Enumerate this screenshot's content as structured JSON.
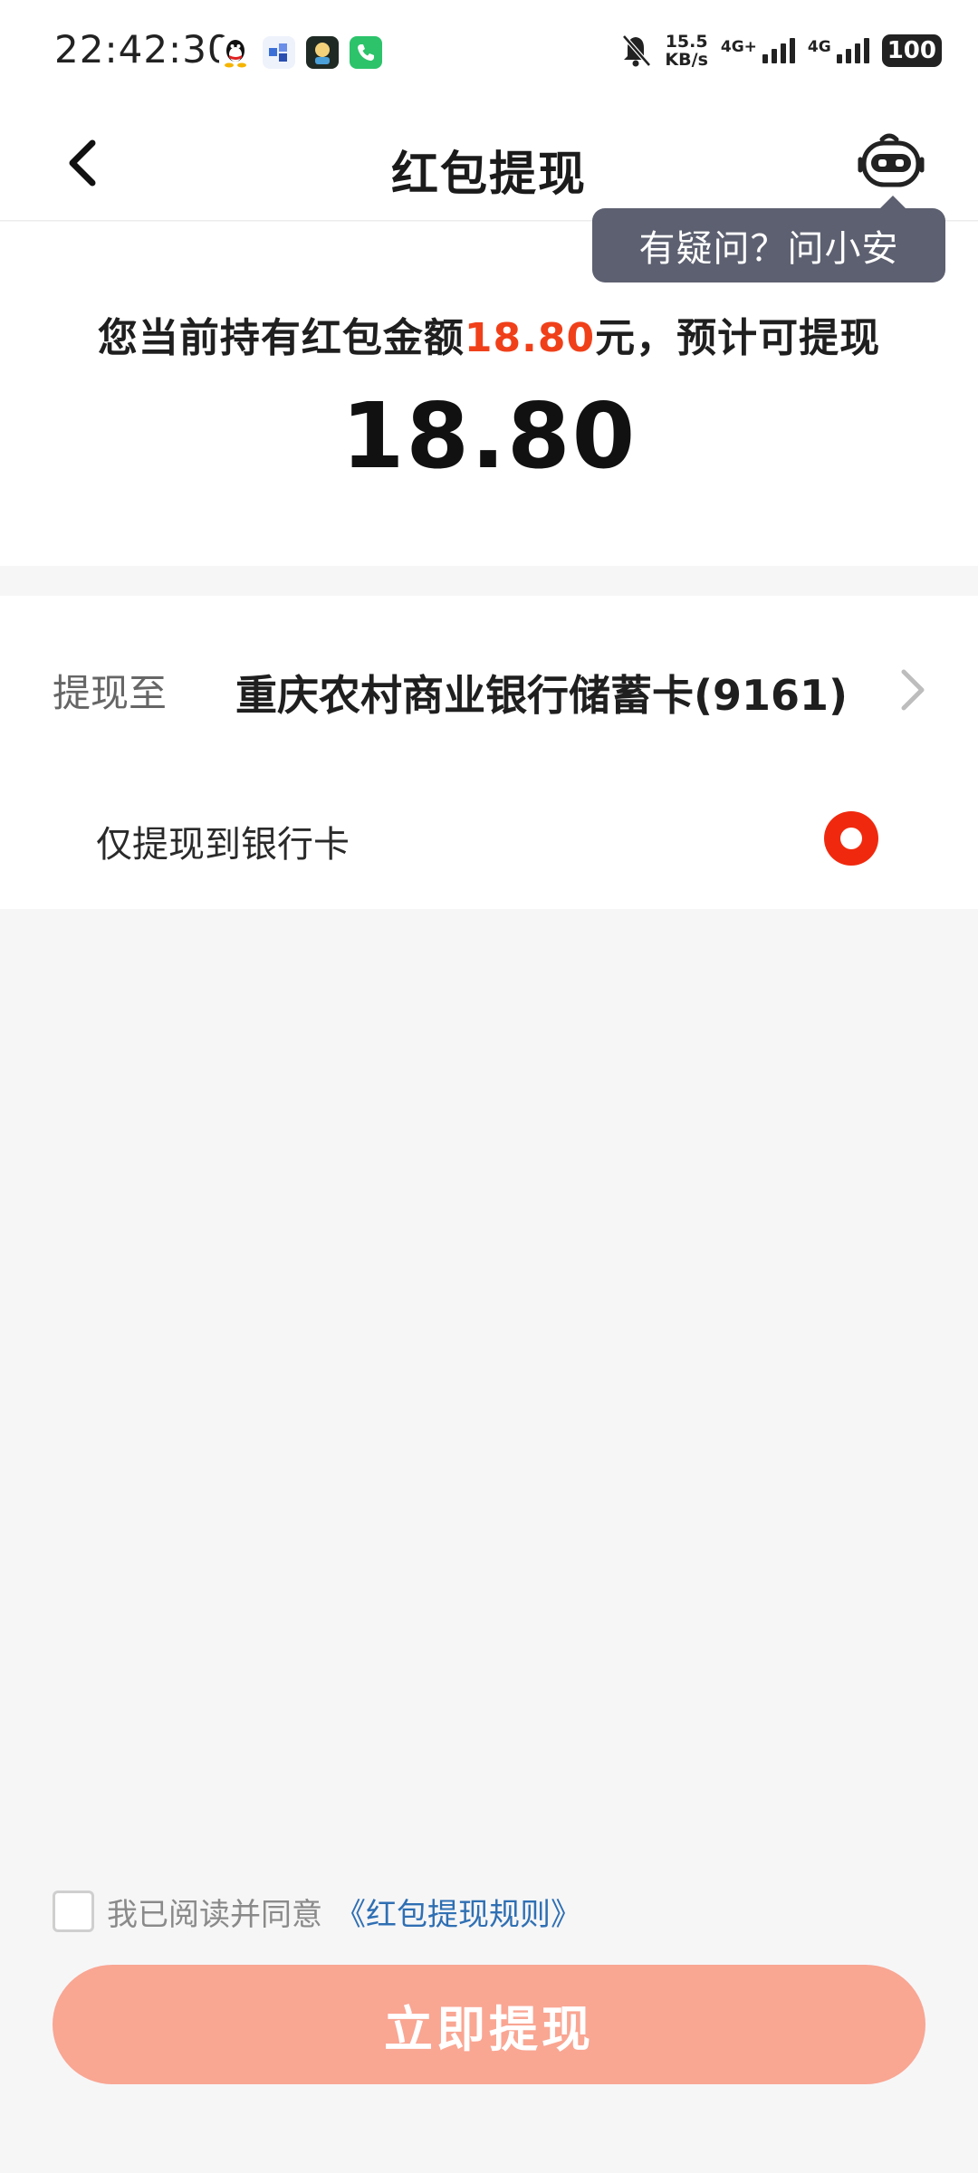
{
  "status_bar": {
    "time": "22:42:30",
    "net_speed_value": "15.5",
    "net_speed_unit": "KB/s",
    "network_1": "4G+",
    "network_2": "4G",
    "battery": "100",
    "app_icons": [
      "qq-icon",
      "app-icon",
      "avatar-app-icon",
      "phone-app-icon"
    ]
  },
  "nav": {
    "title": "红包提现",
    "back_icon": "chevron-left-icon",
    "assistant_icon": "robot-icon"
  },
  "tooltip": {
    "text": "有疑问？问小安"
  },
  "amount": {
    "prefix": "您当前持有红包金额",
    "held_amount": "18.80",
    "suffix": "元，预计可提现",
    "withdrawable": "18.80"
  },
  "target": {
    "label": "提现至",
    "bank": "重庆农村商业银行储蓄卡(9161)",
    "only_bank_label": "仅提现到银行卡",
    "only_bank_selected": true
  },
  "agreement": {
    "text": "我已阅读并同意",
    "link": "《红包提现规则》",
    "checked": false
  },
  "submit": {
    "label": "立即提现"
  },
  "colors": {
    "accent": "#f0401a",
    "radio": "#f0290e",
    "button_disabled": "#f9a693",
    "tooltip_bg": "#5d6070",
    "link": "#2f6fb3"
  }
}
